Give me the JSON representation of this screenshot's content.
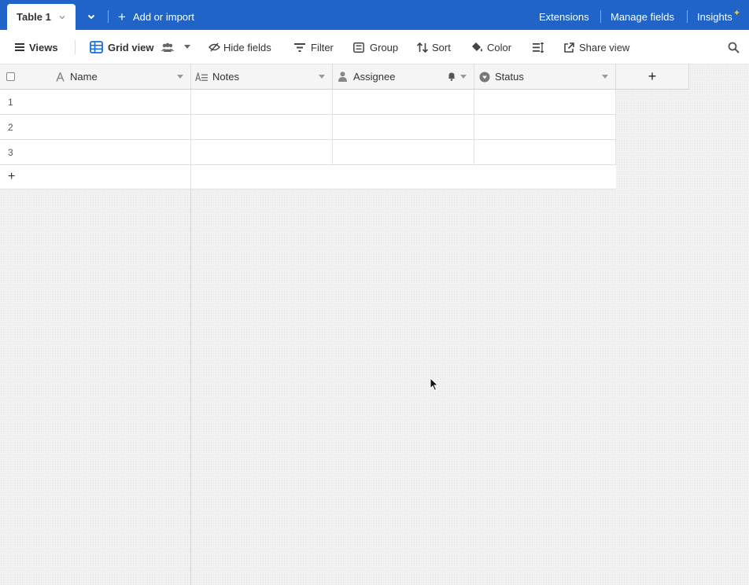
{
  "tabbar": {
    "active_tab": "Table 1",
    "add_import": "Add or import",
    "extensions": "Extensions",
    "manage_fields": "Manage fields",
    "insights": "Insights",
    "sparkle": "✦"
  },
  "viewbar": {
    "views": "Views",
    "grid_view": "Grid view",
    "hide_fields": "Hide fields",
    "filter": "Filter",
    "group": "Group",
    "sort": "Sort",
    "color": "Color",
    "share_view": "Share view"
  },
  "table": {
    "columns": [
      {
        "label": "Name",
        "icon": "text-a-icon"
      },
      {
        "label": "Notes",
        "icon": "long-text-icon"
      },
      {
        "label": "Assignee",
        "icon": "user-icon"
      },
      {
        "label": "Status",
        "icon": "single-select-icon"
      }
    ],
    "add_field": "+",
    "rows": [
      "1",
      "2",
      "3"
    ],
    "add_row": "+"
  },
  "colors": {
    "header_blue": "#1f64c6",
    "grid_bg": "#f2f2f2"
  }
}
